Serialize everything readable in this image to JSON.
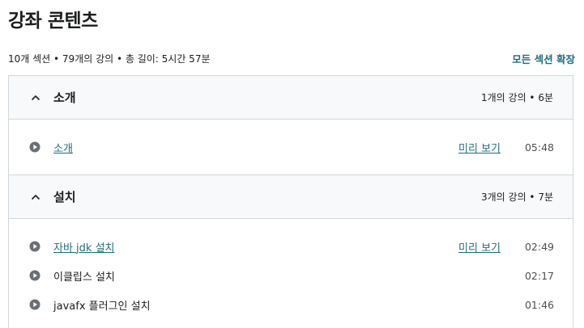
{
  "header": {
    "title": "강좌 콘텐츠"
  },
  "summary": {
    "text": "10개 섹션 • 79개의 강의 • 총 길이: 5시간 57분",
    "expand_all_label": "모든 섹션 확장"
  },
  "sections": [
    {
      "title": "소개",
      "stats": "1개의 강의 • 6분",
      "expanded": true,
      "lectures": [
        {
          "title": "소개",
          "preview": "미리 보기",
          "duration": "05:48",
          "is_link": true
        }
      ]
    },
    {
      "title": "설치",
      "stats": "3개의 강의 • 7분",
      "expanded": true,
      "lectures": [
        {
          "title": "자바 jdk 설치",
          "preview": "미리 보기",
          "duration": "02:49",
          "is_link": true
        },
        {
          "title": "이클립스 설치",
          "duration": "02:17",
          "is_link": false
        },
        {
          "title": "javafx 플러그인 설치",
          "duration": "01:46",
          "is_link": false
        }
      ]
    }
  ],
  "icons": {
    "chevron": "chevron-up-icon",
    "play": "play-circle-icon"
  },
  "colors": {
    "link": "#1e6f7b",
    "text": "#1c1d1f",
    "muted": "#4b4f54",
    "section_bg": "#f7f9fa",
    "border": "#d1d7dc",
    "play_icon": "#6a6f73"
  }
}
